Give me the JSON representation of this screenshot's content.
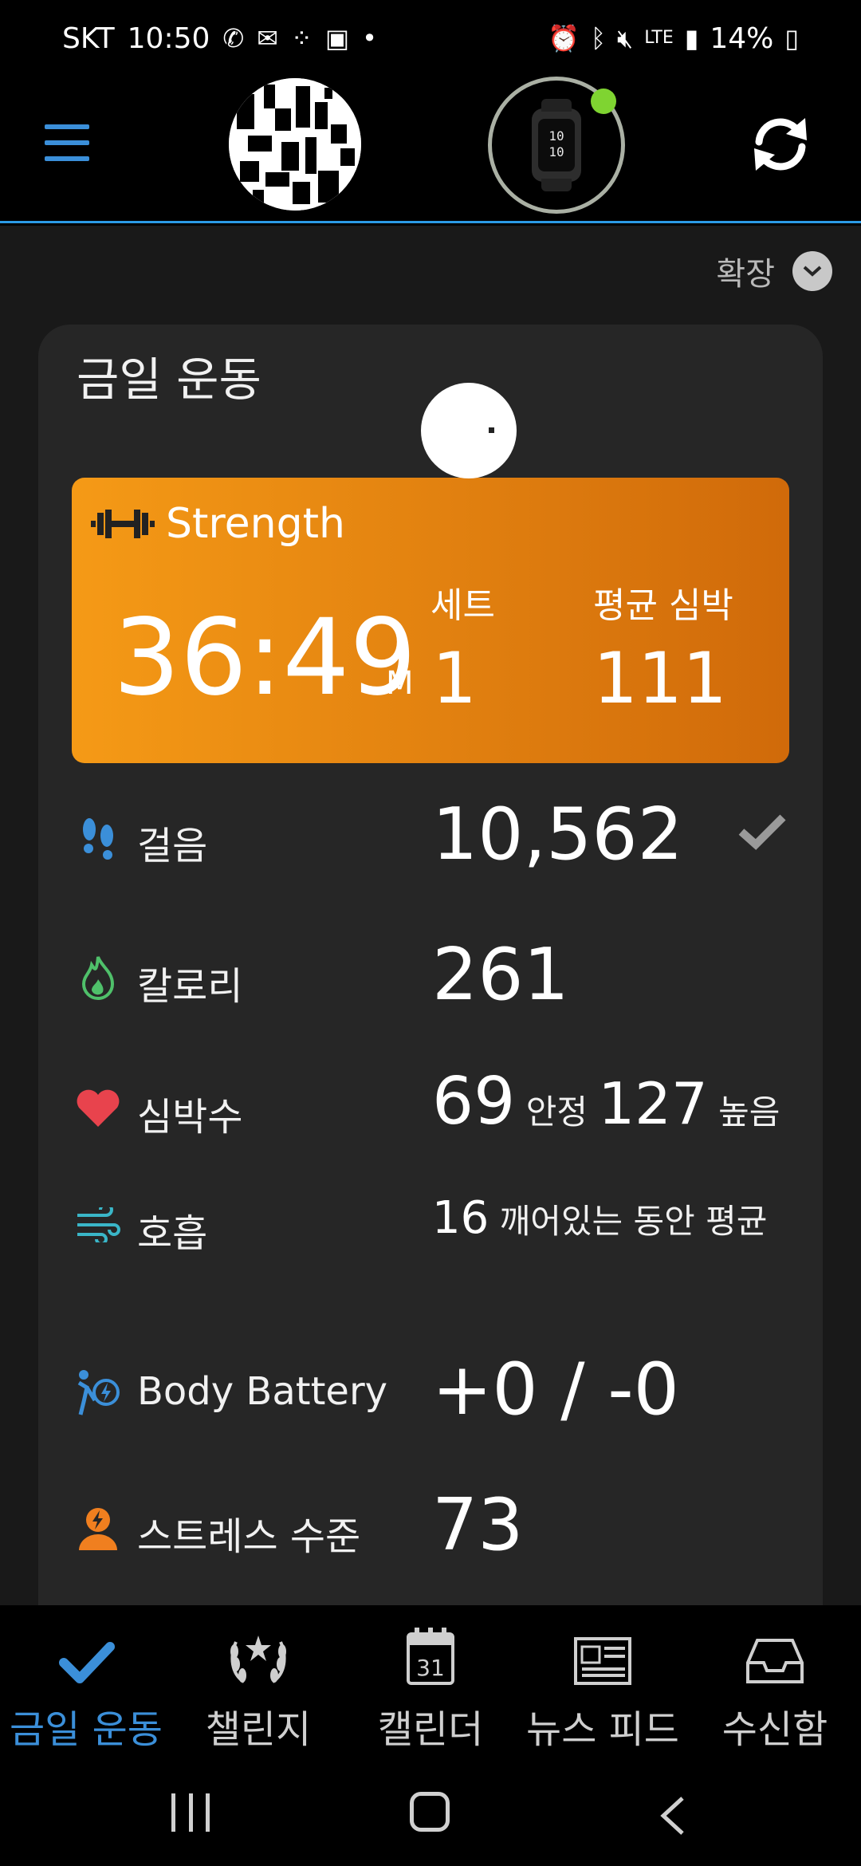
{
  "status_bar": {
    "carrier": "SKT",
    "time": "10:50",
    "network": "LTE",
    "battery": "14%"
  },
  "app_bar": {
    "watch_face_top": "10",
    "watch_face_bottom": "10"
  },
  "main": {
    "expand_label": "확장",
    "card_title": "금일 운동",
    "activity": {
      "type": "Strength",
      "duration": "36:49",
      "duration_unit": "M",
      "sets_label": "세트",
      "sets_value": "1",
      "avg_hr_label": "평균 심박",
      "avg_hr_value": "111"
    },
    "stats": {
      "steps": {
        "label": "걸음",
        "value": "10,562"
      },
      "calories": {
        "label": "칼로리",
        "value": "261"
      },
      "heart_rate": {
        "label": "심박수",
        "resting_value": "69",
        "resting_label": "안정",
        "high_value": "127",
        "high_label": "높음"
      },
      "respiration": {
        "label": "호흡",
        "value": "16",
        "note": "깨어있는 동안 평균"
      },
      "body_battery": {
        "label": "Body Battery",
        "value": "+0 / -0"
      },
      "stress": {
        "label": "스트레스 수준",
        "value": "73"
      }
    }
  },
  "bottom_nav": {
    "items": [
      {
        "label": "금일 운동",
        "icon": "check-icon",
        "active": true
      },
      {
        "label": "챌린지",
        "icon": "laurel-icon",
        "active": false
      },
      {
        "label": "캘린더",
        "icon": "calendar-icon",
        "calendar_day": "31",
        "active": false
      },
      {
        "label": "뉴스 피드",
        "icon": "newspaper-icon",
        "active": false
      },
      {
        "label": "수신함",
        "icon": "inbox-icon",
        "active": false
      }
    ]
  },
  "colors": {
    "accent": "#3b8fd9",
    "activity_start": "#f59a16",
    "activity_end": "#d06a0a",
    "device_connected": "#7fd431"
  }
}
